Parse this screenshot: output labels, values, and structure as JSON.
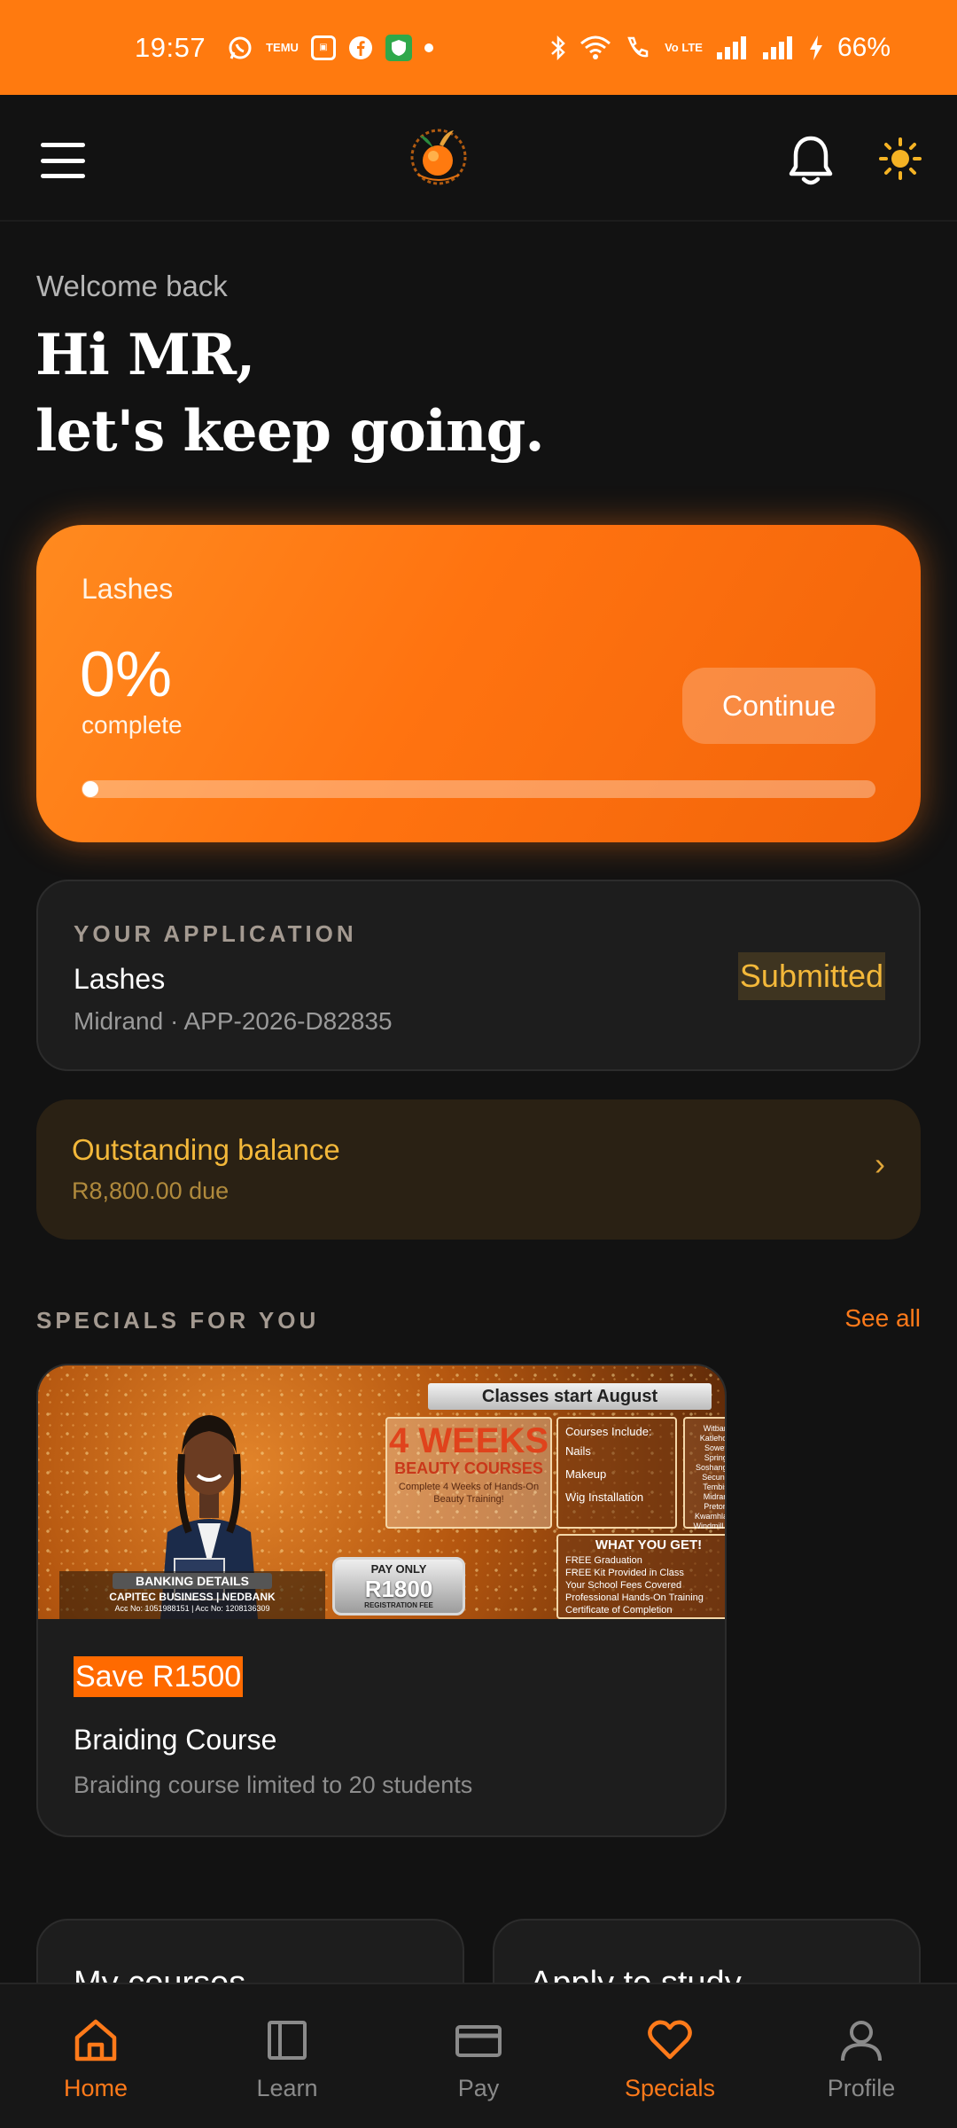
{
  "status_bar": {
    "time": "19:57",
    "notification_icons": [
      "whatsapp-icon",
      "temu-icon",
      "contacts-icon",
      "facebook-icon",
      "shield-icon",
      "dot"
    ],
    "temu_text": "TEMU",
    "volte_text": "Vo LTE",
    "battery": "66%"
  },
  "app_bar": {
    "icons": [
      "menu-icon",
      "logo",
      "bell-icon",
      "sun-icon"
    ]
  },
  "greeting": {
    "welcome": "Welcome back",
    "line1": "Hi MR,",
    "line2": "let's keep going."
  },
  "progress_card": {
    "course": "Lashes",
    "percent_text": "0%",
    "complete_label": "complete",
    "continue_label": "Continue",
    "progress": 0
  },
  "application": {
    "heading": "YOUR APPLICATION",
    "course": "Lashes",
    "meta": "Midrand · APP-2026-D82835",
    "status": "Submitted"
  },
  "balance": {
    "title": "Outstanding balance",
    "due": "R8,800.00 due",
    "chevron": "›"
  },
  "specials": {
    "heading": "SPECIALS FOR YOU",
    "see_all": "See all",
    "card": {
      "badge": "Save R1500",
      "title": "Braiding Course",
      "description": "Braiding course limited to 20 students",
      "promo": {
        "banner": "Classes start August",
        "weeks": "4 WEEKS",
        "beauty_courses": "BEAUTY COURSES",
        "weeks_sub": "Complete 4 Weeks of Hands-On Beauty Training!",
        "includes_title": "Courses Include:",
        "includes": [
          "Nails",
          "Makeup",
          "Wig Installation"
        ],
        "areas": [
          "Witbank",
          "Katlehong",
          "Soweto",
          "Springs",
          "Soshanguve",
          "Secunda",
          "Tembisa",
          "Midrand",
          "Pretoria",
          "Kwamhlanga",
          "Windmill Park"
        ],
        "get_title": "WHAT YOU GET!",
        "get_items": [
          "FREE Graduation",
          "FREE Kit Provided in Class",
          "Your School Fees Covered",
          "Professional Hands-On Training",
          "Certificate of Completion"
        ],
        "price_line1": "PAY ONLY",
        "price": "R1800",
        "price_line3": "REGISTRATION FEE",
        "bank_title": "BANKING DETAILS",
        "bank_names": "CAPITEC BUSINESS | NEDBANK",
        "bank_accounts": "Acc No: 1051988151 | Acc No: 1208136309"
      }
    }
  },
  "quick_links": {
    "my_courses": "My courses",
    "apply": "Apply to study"
  },
  "bottom_nav": {
    "items": [
      {
        "label": "Home",
        "icon": "home-icon"
      },
      {
        "label": "Learn",
        "icon": "book-icon"
      },
      {
        "label": "Pay",
        "icon": "card-icon"
      },
      {
        "label": "Specials",
        "icon": "heart-icon"
      },
      {
        "label": "Profile",
        "icon": "person-icon"
      }
    ]
  },
  "colors": {
    "accent": "#ff7a0f",
    "background": "#121212",
    "card": "#1d1d1d",
    "warning": "#f3b83a"
  }
}
